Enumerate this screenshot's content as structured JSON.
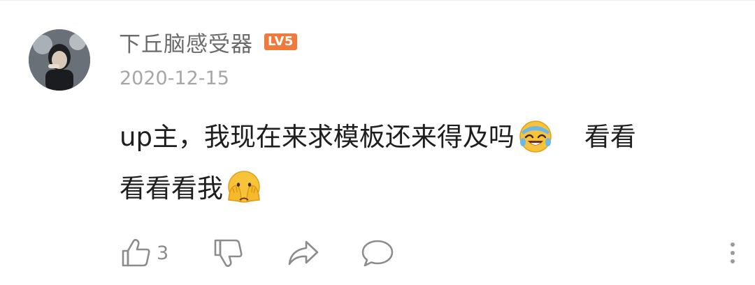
{
  "comment": {
    "username": "下丘脑感受器",
    "level_badge": "LV5",
    "date": "2020-12-15",
    "text_part1": "up主，我现在来求模板还来得及吗",
    "emoji1": "laughing-crying-emoji",
    "text_part2": "看看",
    "text_part3": "看看看我",
    "emoji2": "covering-face-emoji"
  },
  "actions": {
    "like_count": "3",
    "like_icon": "thumbs-up-icon",
    "dislike_icon": "thumbs-down-icon",
    "share_icon": "share-icon",
    "reply_icon": "reply-bubble-icon",
    "more_icon": "more-vertical-icon"
  },
  "colors": {
    "badge": "#f07a3c",
    "username": "#6b6b6b",
    "date": "#a6a6a6",
    "text": "#1e1e1e",
    "icon": "#8c8c8c"
  }
}
